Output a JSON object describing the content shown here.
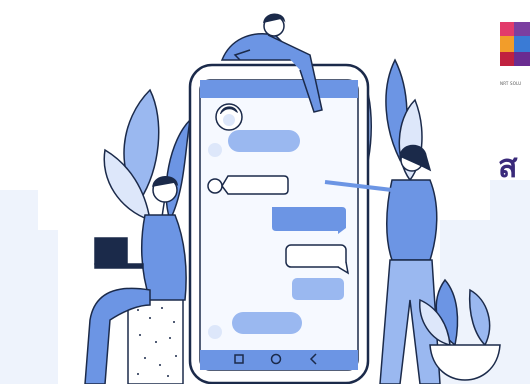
{
  "brand": {
    "logo_icon": "puzzle-icon",
    "logo_caption": "NRT SOLU",
    "title_fragment": "ส"
  },
  "phone": {
    "nav_icons": [
      "square-icon",
      "circle-icon",
      "back-chevron-icon"
    ]
  },
  "colors": {
    "accent": "#6c95e4",
    "accent_light": "#9ab8f0",
    "accent_pale": "#dde7fa",
    "outline": "#1b2a4a",
    "brand_purple": "#3a2a7a"
  }
}
